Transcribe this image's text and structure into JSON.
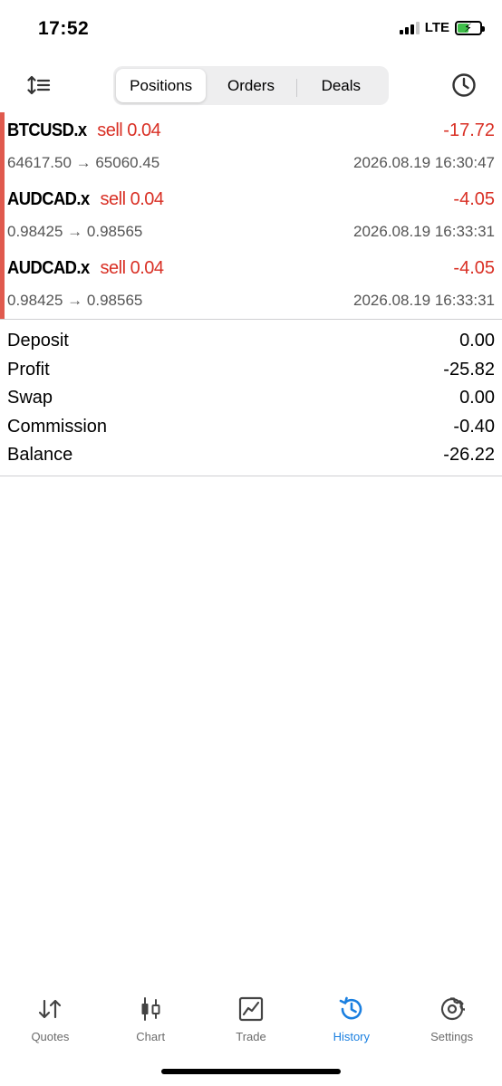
{
  "status_bar": {
    "time": "17:52",
    "network": "LTE",
    "battery_level": 0.48,
    "battery_charging": true
  },
  "toolbar": {
    "sort_icon": "sort-icon",
    "history_icon": "clock-icon",
    "segments": [
      {
        "label": "Positions",
        "active": true
      },
      {
        "label": "Orders",
        "active": false
      },
      {
        "label": "Deals",
        "active": false
      }
    ]
  },
  "deals": [
    {
      "symbol": "BTCUSD.x",
      "side": "sell 0.04",
      "profit": "-17.72",
      "prices": "64617.50 → 65060.45",
      "time": "2026.08.19 16:30:47"
    },
    {
      "symbol": "AUDCAD.x",
      "side": "sell 0.04",
      "profit": "-4.05",
      "prices": "0.98425 → 0.98565",
      "time": "2026.08.19 16:33:31"
    },
    {
      "symbol": "AUDCAD.x",
      "side": "sell 0.04",
      "profit": "-4.05",
      "prices": "0.98425 → 0.98565",
      "time": "2026.08.19 16:33:31"
    }
  ],
  "summary": [
    {
      "label": "Deposit",
      "value": "0.00"
    },
    {
      "label": "Profit",
      "value": "-25.82"
    },
    {
      "label": "Swap",
      "value": "0.00"
    },
    {
      "label": "Commission",
      "value": "-0.40"
    },
    {
      "label": "Balance",
      "value": "-26.22"
    }
  ],
  "tabs": [
    {
      "label": "Quotes",
      "icon": "quotes-icon",
      "active": false
    },
    {
      "label": "Chart",
      "icon": "candlestick-icon",
      "active": false
    },
    {
      "label": "Trade",
      "icon": "trade-chart-icon",
      "active": false
    },
    {
      "label": "History",
      "icon": "history-icon",
      "active": true
    },
    {
      "label": "Settings",
      "icon": "gear-icon",
      "active": false
    }
  ],
  "colors": {
    "loss": "#d93025",
    "accent": "#1a7fe0",
    "deal_marker": "#e05a4e",
    "battery": "#3fbf4a"
  }
}
